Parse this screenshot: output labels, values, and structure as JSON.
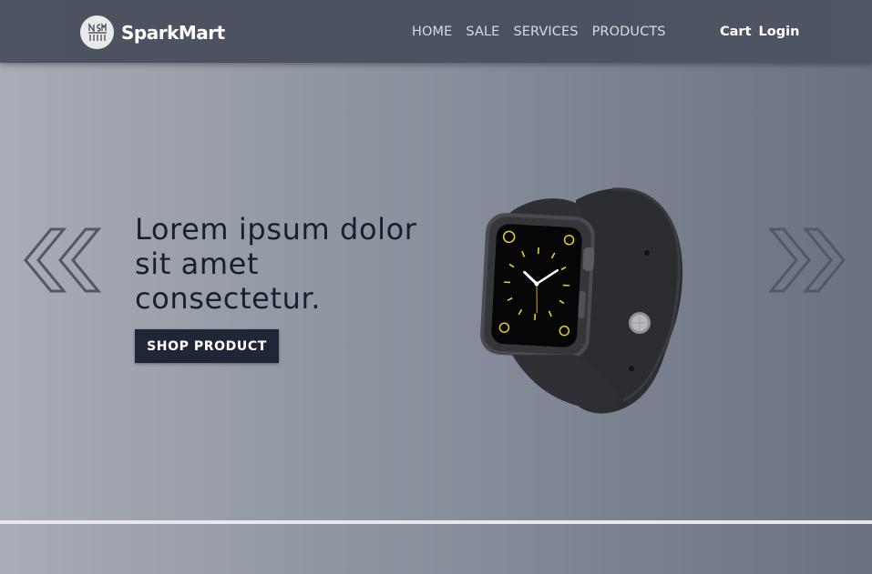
{
  "header": {
    "brand": "SparkMart",
    "logo_text": "NSM",
    "nav": [
      "HOME",
      "SALE",
      "SERVICES",
      "PRODUCTS"
    ],
    "cart": "Cart",
    "login": "Login"
  },
  "hero": {
    "headline": "Lorem ipsum dolor sit amet consectetur.",
    "cta": "SHOP PRODUCT",
    "prev_icon": "chevrons-left-icon",
    "next_icon": "chevrons-right-icon",
    "product_image": "smartwatch"
  },
  "colors": {
    "nav_bg": "#4d5360",
    "button_bg": "#1f2737",
    "headline": "#18202e"
  }
}
